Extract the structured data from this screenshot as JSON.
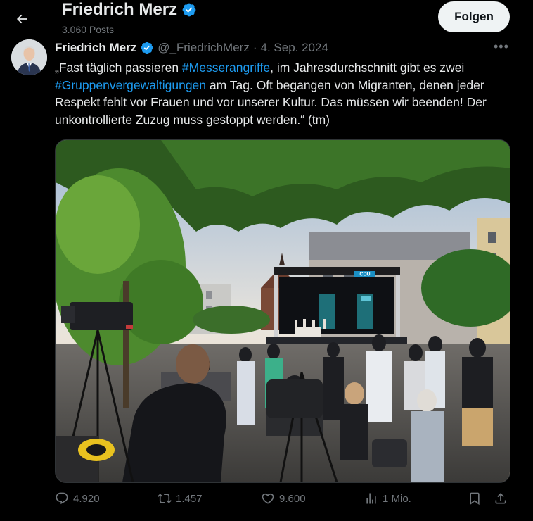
{
  "header": {
    "title": "Friedrich Merz",
    "posts_count": "3.060 Posts",
    "follow_label": "Folgen"
  },
  "tweet": {
    "author_name": "Friedrich Merz",
    "handle": "@_FriedrichMerz",
    "separator": "·",
    "date": "4. Sep. 2024",
    "more": "•••",
    "text_parts": {
      "p1": "„Fast täglich passieren ",
      "h1": "#Messerangriffe",
      "p2": ", im Jahresdurchschnitt gibt es zwei ",
      "h2": "#Gruppenvergewaltigungen",
      "p3": " am Tag. Oft begangen von Migranten, denen jeder Respekt fehlt vor Frauen und vor unserer Kultur. Das müssen wir beenden! Der unkontrollierte Zuzug muss gestoppt werden.“ (tm)"
    },
    "stage_banner": "CDU"
  },
  "actions": {
    "replies": "4.920",
    "reposts": "1.457",
    "likes": "9.600",
    "views": "1 Mio."
  },
  "colors": {
    "accent": "#1d9bf0",
    "background": "#000000",
    "text": "#e7e9ea",
    "muted": "#71767b"
  },
  "icons": [
    "back-arrow-icon",
    "verified-badge-icon",
    "more-icon",
    "reply-icon",
    "repost-icon",
    "like-icon",
    "views-icon",
    "bookmark-icon",
    "share-icon"
  ]
}
